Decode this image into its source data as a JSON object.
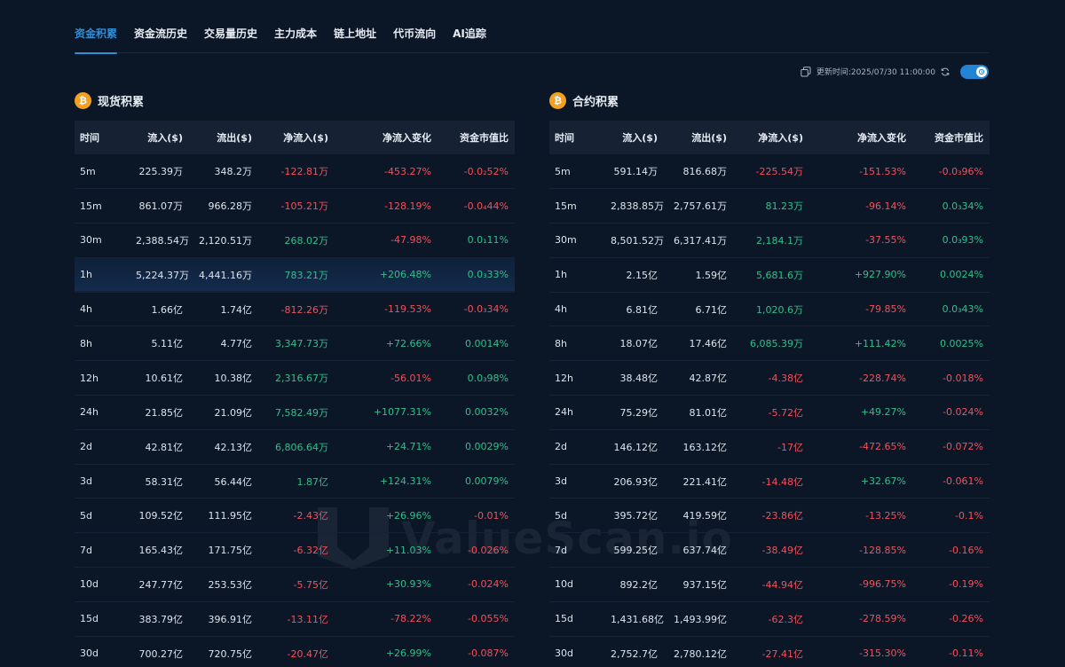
{
  "tabs": [
    {
      "label": "资金积累",
      "active": true
    },
    {
      "label": "资金流历史",
      "active": false
    },
    {
      "label": "交易量历史",
      "active": false
    },
    {
      "label": "主力成本",
      "active": false
    },
    {
      "label": "链上地址",
      "active": false
    },
    {
      "label": "代币流向",
      "active": false
    },
    {
      "label": "AI追踪",
      "active": false
    }
  ],
  "update": {
    "label": "更新时间:2025/07/30 11:00:00",
    "toggle_on": true
  },
  "colors": {
    "accent": "#2f8fd8",
    "positive": "#2fc08b",
    "negative": "#f0525c",
    "btc": "#f2a122"
  },
  "watermark": "ValueScan.io",
  "headers": [
    "时间",
    "流入($)",
    "流出($)",
    "净流入($)",
    "净流入变化",
    "资金市值比"
  ],
  "spot": {
    "title": "现货积累",
    "icon": "bitcoin-icon",
    "rows": [
      [
        "5m",
        "225.39万",
        "348.2万",
        "-122.81万",
        "-453.27%",
        "-0.0₂52%"
      ],
      [
        "15m",
        "861.07万",
        "966.28万",
        "-105.21万",
        "-128.19%",
        "-0.0₄44%"
      ],
      [
        "30m",
        "2,388.54万",
        "2,120.51万",
        "268.02万",
        "-47.98%",
        "0.0₁11%"
      ],
      [
        "1h",
        "5,224.37万",
        "4,441.16万",
        "783.21万",
        "+206.48%",
        "0.0₃33%"
      ],
      [
        "4h",
        "1.66亿",
        "1.74亿",
        "-812.26万",
        "-119.53%",
        "-0.0₃34%"
      ],
      [
        "8h",
        "5.11亿",
        "4.77亿",
        "3,347.73万",
        "+72.66%",
        "0.0014%"
      ],
      [
        "12h",
        "10.61亿",
        "10.38亿",
        "2,316.67万",
        "-56.01%",
        "0.0₃98%"
      ],
      [
        "24h",
        "21.85亿",
        "21.09亿",
        "7,582.49万",
        "+1077.31%",
        "0.0032%"
      ],
      [
        "2d",
        "42.81亿",
        "42.13亿",
        "6,806.64万",
        "+24.71%",
        "0.0029%"
      ],
      [
        "3d",
        "58.31亿",
        "56.44亿",
        "1.87亿",
        "+124.31%",
        "0.0079%"
      ],
      [
        "5d",
        "109.52亿",
        "111.95亿",
        "-2.43亿",
        "+26.96%",
        "-0.01%"
      ],
      [
        "7d",
        "165.43亿",
        "171.75亿",
        "-6.32亿",
        "+11.03%",
        "-0.026%"
      ],
      [
        "10d",
        "247.77亿",
        "253.53亿",
        "-5.75亿",
        "+30.93%",
        "-0.024%"
      ],
      [
        "15d",
        "383.79亿",
        "396.91亿",
        "-13.11亿",
        "-78.22%",
        "-0.055%"
      ],
      [
        "30d",
        "700.27亿",
        "720.75亿",
        "-20.47亿",
        "+26.99%",
        "-0.087%"
      ]
    ]
  },
  "futures": {
    "title": "合约积累",
    "icon": "bitcoin-icon",
    "rows": [
      [
        "5m",
        "591.14万",
        "816.68万",
        "-225.54万",
        "-151.53%",
        "-0.0₃96%"
      ],
      [
        "15m",
        "2,838.85万",
        "2,757.61万",
        "81.23万",
        "-96.14%",
        "0.0₃34%"
      ],
      [
        "30m",
        "8,501.52万",
        "6,317.41万",
        "2,184.1万",
        "-37.55%",
        "0.0₃93%"
      ],
      [
        "1h",
        "2.15亿",
        "1.59亿",
        "5,681.6万",
        "+927.90%",
        "0.0024%"
      ],
      [
        "4h",
        "6.81亿",
        "6.71亿",
        "1,020.6万",
        "-79.85%",
        "0.0₃43%"
      ],
      [
        "8h",
        "18.07亿",
        "17.46亿",
        "6,085.39万",
        "+111.42%",
        "0.0025%"
      ],
      [
        "12h",
        "38.48亿",
        "42.87亿",
        "-4.38亿",
        "-228.74%",
        "-0.018%"
      ],
      [
        "24h",
        "75.29亿",
        "81.01亿",
        "-5.72亿",
        "+49.27%",
        "-0.024%"
      ],
      [
        "2d",
        "146.12亿",
        "163.12亿",
        "-17亿",
        "-472.65%",
        "-0.072%"
      ],
      [
        "3d",
        "206.93亿",
        "221.41亿",
        "-14.48亿",
        "+32.67%",
        "-0.061%"
      ],
      [
        "5d",
        "395.72亿",
        "419.59亿",
        "-23.86亿",
        "-13.25%",
        "-0.1%"
      ],
      [
        "7d",
        "599.25亿",
        "637.74亿",
        "-38.49亿",
        "-128.85%",
        "-0.16%"
      ],
      [
        "10d",
        "892.2亿",
        "937.15亿",
        "-44.94亿",
        "-996.75%",
        "-0.19%"
      ],
      [
        "15d",
        "1,431.68亿",
        "1,493.99亿",
        "-62.3亿",
        "-278.59%",
        "-0.26%"
      ],
      [
        "30d",
        "2,752.7亿",
        "2,780.12亿",
        "-27.41亿",
        "-315.30%",
        "-0.11%"
      ]
    ]
  }
}
